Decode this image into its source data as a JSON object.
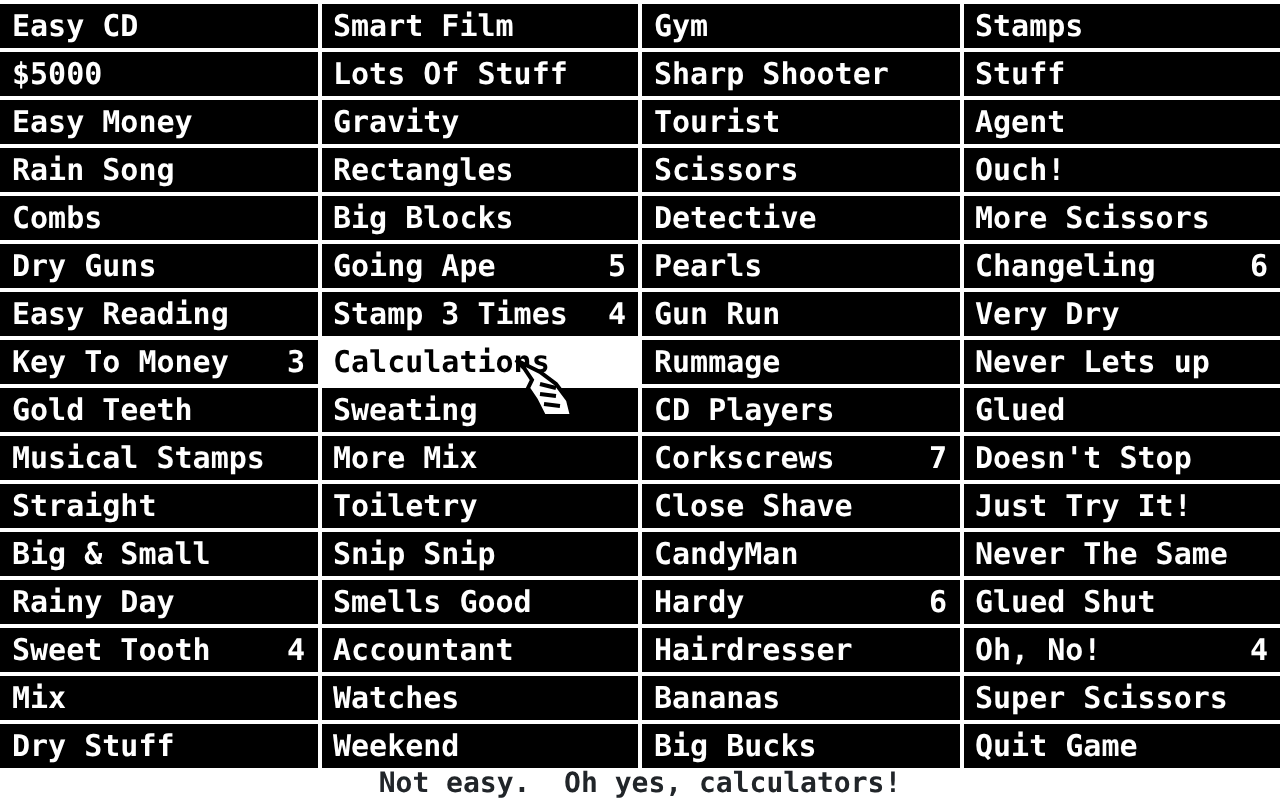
{
  "columns": [
    {
      "items": [
        {
          "label": "Easy CD",
          "selected": false
        },
        {
          "label": "$5000",
          "selected": false
        },
        {
          "label": "Easy Money",
          "selected": false
        },
        {
          "label": "Rain Song",
          "selected": false
        },
        {
          "label": "Combs",
          "selected": false
        },
        {
          "label": "Dry Guns",
          "selected": false
        },
        {
          "label": "Easy Reading",
          "selected": false
        },
        {
          "label": "Key To Money",
          "count": "3",
          "selected": false
        },
        {
          "label": "Gold Teeth",
          "selected": false
        },
        {
          "label": "Musical Stamps",
          "selected": false
        },
        {
          "label": "Straight",
          "selected": false
        },
        {
          "label": "Big & Small",
          "selected": false
        },
        {
          "label": "Rainy Day",
          "selected": false
        },
        {
          "label": "Sweet Tooth",
          "count": "4",
          "selected": false
        },
        {
          "label": "Mix",
          "selected": false
        },
        {
          "label": "Dry Stuff",
          "selected": false
        }
      ]
    },
    {
      "items": [
        {
          "label": "Smart Film",
          "selected": false
        },
        {
          "label": "Lots Of Stuff",
          "selected": false
        },
        {
          "label": "Gravity",
          "selected": false
        },
        {
          "label": "Rectangles",
          "selected": false
        },
        {
          "label": "Big Blocks",
          "selected": false
        },
        {
          "label": "Going Ape",
          "count": "5",
          "selected": false
        },
        {
          "label": "Stamp 3 Times",
          "count": "4",
          "selected": false
        },
        {
          "label": "Calculations",
          "selected": true
        },
        {
          "label": "Sweating",
          "selected": false
        },
        {
          "label": "More Mix",
          "selected": false
        },
        {
          "label": "Toiletry",
          "selected": false
        },
        {
          "label": "Snip Snip",
          "selected": false
        },
        {
          "label": "Smells Good",
          "selected": false
        },
        {
          "label": "Accountant",
          "selected": false
        },
        {
          "label": "Watches",
          "selected": false
        },
        {
          "label": "Weekend",
          "selected": false
        }
      ]
    },
    {
      "items": [
        {
          "label": "Gym",
          "selected": false
        },
        {
          "label": "Sharp Shooter",
          "selected": false
        },
        {
          "label": "Tourist",
          "selected": false
        },
        {
          "label": "Scissors",
          "selected": false
        },
        {
          "label": "Detective",
          "selected": false
        },
        {
          "label": "Pearls",
          "selected": false
        },
        {
          "label": "Gun Run",
          "selected": false
        },
        {
          "label": "Rummage",
          "selected": false
        },
        {
          "label": "CD Players",
          "selected": false
        },
        {
          "label": "Corkscrews",
          "count": "7",
          "selected": false
        },
        {
          "label": "Close Shave",
          "selected": false
        },
        {
          "label": "CandyMan",
          "selected": false
        },
        {
          "label": "Hardy",
          "count": "6",
          "selected": false
        },
        {
          "label": "Hairdresser",
          "selected": false
        },
        {
          "label": "Bananas",
          "selected": false
        },
        {
          "label": "Big Bucks",
          "selected": false
        }
      ]
    },
    {
      "items": [
        {
          "label": "Stamps",
          "selected": false
        },
        {
          "label": "Stuff",
          "selected": false
        },
        {
          "label": "Agent",
          "selected": false
        },
        {
          "label": "Ouch!",
          "selected": false
        },
        {
          "label": "More Scissors",
          "selected": false
        },
        {
          "label": "Changeling",
          "count": "6",
          "selected": false
        },
        {
          "label": "Very Dry",
          "selected": false
        },
        {
          "label": "Never Lets up",
          "selected": false
        },
        {
          "label": "Glued",
          "selected": false
        },
        {
          "label": "Doesn't Stop",
          "selected": false
        },
        {
          "label": "Just Try It!",
          "selected": false
        },
        {
          "label": "Never The Same",
          "selected": false
        },
        {
          "label": "Glued Shut",
          "selected": false
        },
        {
          "label": "Oh, No!",
          "count": "4",
          "selected": false
        },
        {
          "label": "Super Scissors",
          "selected": false
        },
        {
          "label": "Quit Game",
          "selected": false
        }
      ]
    }
  ],
  "status_bar": "Not easy.  Oh yes, calculators!"
}
